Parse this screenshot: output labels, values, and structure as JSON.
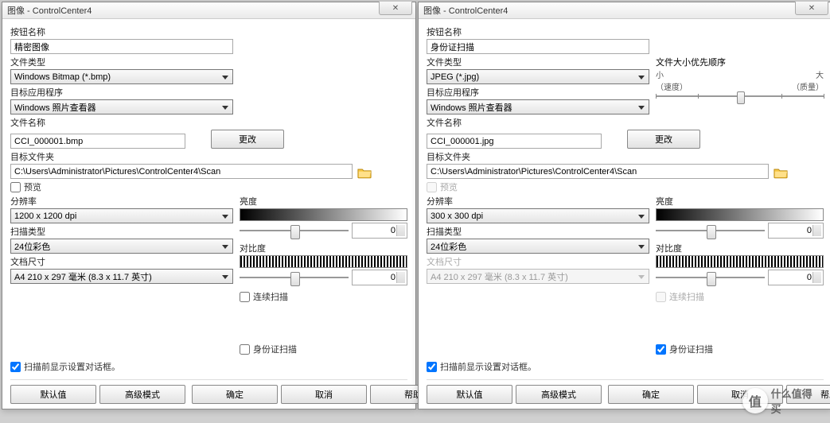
{
  "left": {
    "title": "图像 - ControlCenter4",
    "button_name_label": "按钮名称",
    "button_name_value": "精密图像",
    "file_type_label": "文件类型",
    "file_type_value": "Windows Bitmap (*.bmp)",
    "target_app_label": "目标应用程序",
    "target_app_value": "Windows 照片查看器",
    "filename_label": "文件名称",
    "filename_value": "CCI_000001.bmp",
    "change_btn": "更改",
    "target_folder_label": "目标文件夹",
    "target_folder_value": "C:\\Users\\Administrator\\Pictures\\ControlCenter4\\Scan",
    "preview_label": "预览",
    "resolution_label": "分辨率",
    "resolution_value": "1200 x 1200 dpi",
    "scan_type_label": "扫描类型",
    "scan_type_value": "24位彩色",
    "doc_size_label": "文档尺寸",
    "doc_size_value": "A4 210 x 297 毫米 (8.3 x 11.7 英寸)",
    "brightness_label": "亮度",
    "brightness_value": "0",
    "contrast_label": "对比度",
    "contrast_value": "0",
    "continuous_scan": "连续扫描",
    "id_scan": "身份证扫描",
    "show_settings": "扫描前显示设置对话框。",
    "btn_default": "默认值",
    "btn_advanced": "高级模式",
    "btn_ok": "确定",
    "btn_cancel": "取消",
    "btn_help": "帮助"
  },
  "right": {
    "title": "图像 - ControlCenter4",
    "button_name_label": "按钮名称",
    "button_name_value": "身份证扫描",
    "file_type_label": "文件类型",
    "file_type_value": "JPEG (*.jpg)",
    "size_priority_label": "文件大小优先顺序",
    "size_small": "小",
    "size_large": "大",
    "size_speed": "（速度）",
    "size_quality": "（质量）",
    "target_app_label": "目标应用程序",
    "target_app_value": "Windows 照片查看器",
    "filename_label": "文件名称",
    "filename_value": "CCI_000001.jpg",
    "change_btn": "更改",
    "target_folder_label": "目标文件夹",
    "target_folder_value": "C:\\Users\\Administrator\\Pictures\\ControlCenter4\\Scan",
    "preview_label": "预览",
    "resolution_label": "分辨率",
    "resolution_value": "300 x 300 dpi",
    "scan_type_label": "扫描类型",
    "scan_type_value": "24位彩色",
    "doc_size_label": "文档尺寸",
    "doc_size_value": "A4 210 x 297 毫米 (8.3 x 11.7 英寸)",
    "brightness_label": "亮度",
    "brightness_value": "0",
    "contrast_label": "对比度",
    "contrast_value": "0",
    "continuous_scan": "连续扫描",
    "id_scan": "身份证扫描",
    "show_settings": "扫描前显示设置对话框。",
    "btn_default": "默认值",
    "btn_advanced": "高级模式",
    "btn_ok": "确定",
    "btn_cancel": "取消",
    "btn_help": "帮助"
  },
  "watermark": "什么值得买"
}
